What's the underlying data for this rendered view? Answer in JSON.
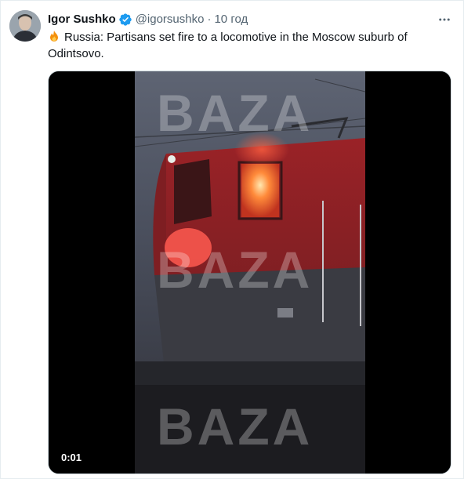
{
  "tweet": {
    "author_name": "Igor Sushko",
    "author_handle": "@igorsushko",
    "separator": "·",
    "time": "10 год",
    "text": "Russia: Partisans set fire to a locomotive in the Moscow suburb of Odintsovo.",
    "icons": {
      "verified": "verified-badge-icon",
      "more": "more-options-icon",
      "emoji": "fire-emoji-icon"
    }
  },
  "video": {
    "watermark": "BAZA",
    "timestamp": "0:01"
  },
  "colors": {
    "verified_blue": "#1d9bf0",
    "text_secondary": "#536471",
    "locomotive_red": "#a5262b"
  }
}
